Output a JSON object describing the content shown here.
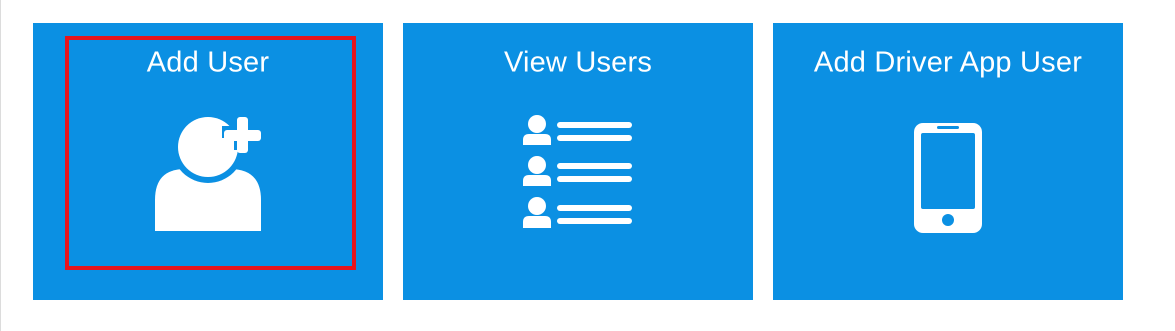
{
  "tiles": [
    {
      "title": "Add User",
      "icon": "add-user-icon",
      "highlighted": true
    },
    {
      "title": "View Users",
      "icon": "user-list-icon",
      "highlighted": false
    },
    {
      "title": "Add Driver App User",
      "icon": "mobile-phone-icon",
      "highlighted": false
    }
  ],
  "colors": {
    "tile_background": "#0b90e3",
    "icon": "#ffffff",
    "highlight_border": "#e8141c"
  }
}
